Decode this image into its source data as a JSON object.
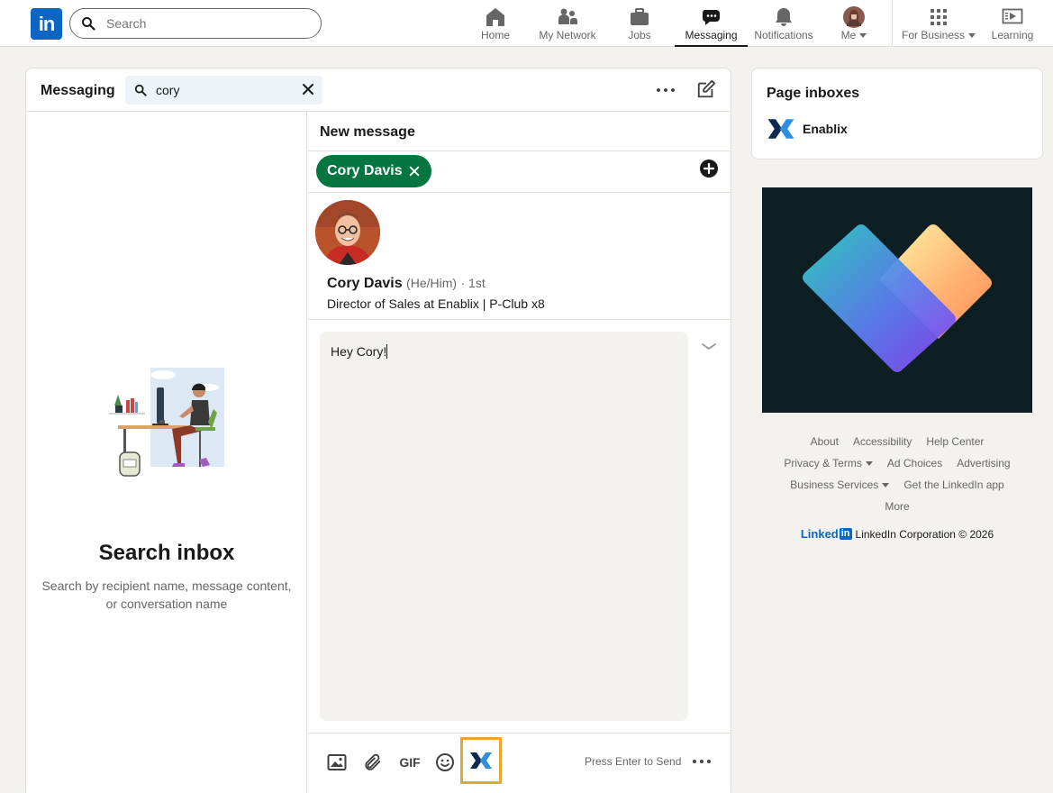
{
  "brand": {
    "logo_text": "in"
  },
  "search": {
    "placeholder": "Search"
  },
  "nav": {
    "items": [
      {
        "label": "Home",
        "icon": "home-icon"
      },
      {
        "label": "My Network",
        "icon": "network-icon"
      },
      {
        "label": "Jobs",
        "icon": "briefcase-icon"
      },
      {
        "label": "Messaging",
        "icon": "messaging-icon",
        "active": true
      },
      {
        "label": "Notifications",
        "icon": "bell-icon"
      },
      {
        "label": "Me",
        "icon": "avatar"
      },
      {
        "label": "For Business",
        "icon": "grid-icon"
      },
      {
        "label": "Learning",
        "icon": "learning-icon"
      }
    ]
  },
  "messaging": {
    "title": "Messaging",
    "search_value": "cory",
    "empty_state": {
      "title": "Search inbox",
      "subtitle": "Search by recipient name, message content, or conversation name"
    }
  },
  "new_message": {
    "title": "New message",
    "recipient_pill": "Cory Davis",
    "profile": {
      "name": "Cory Davis",
      "pronouns": "(He/Him)",
      "degree": "· 1st",
      "headline": "Director of Sales at Enablix | P-Club x8"
    },
    "draft": "Hey Cory!",
    "toolbar": {
      "gif_label": "GIF",
      "hint": "Press Enter to Send"
    }
  },
  "page_inboxes": {
    "title": "Page inboxes",
    "items": [
      {
        "name": "Enablix"
      }
    ]
  },
  "footer": {
    "rows": [
      [
        "About",
        "Accessibility",
        "Help Center"
      ],
      [
        "Privacy & Terms",
        "Ad Choices",
        "Advertising"
      ],
      [
        "Business Services",
        "Get the LinkedIn app"
      ],
      [
        "More"
      ]
    ],
    "brand_word": "Linked",
    "brand_box": "in",
    "copyright": "LinkedIn Corporation © 2026"
  },
  "colors": {
    "accent": "#0a66c2",
    "pill": "#057642",
    "highlight": "#e8a62d",
    "background": "#f4f2ee"
  }
}
